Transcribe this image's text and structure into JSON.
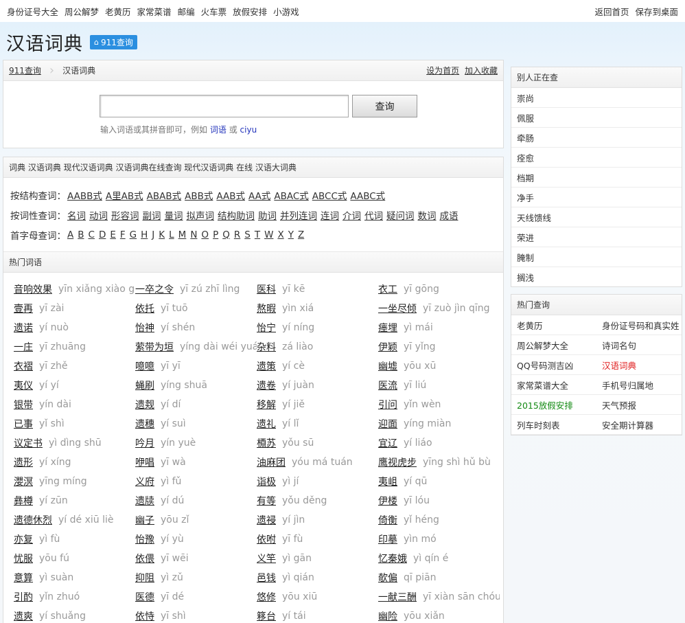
{
  "topbar": {
    "left_links": [
      "身份证号大全",
      "周公解梦",
      "老黄历",
      "家常菜谱",
      "邮编",
      "火车票",
      "放假安排",
      "小游戏"
    ],
    "right_links": [
      "返回首页",
      "保存到桌面"
    ]
  },
  "brand": {
    "title": "汉语词典",
    "badge": "911查询"
  },
  "search_panel": {
    "crumb_home": "911查询",
    "crumb_current": "汉语词典",
    "set_home": "设为首页",
    "add_fav": "加入收藏",
    "input_value": "",
    "button": "查询",
    "hint_prefix": "输入词语或其拼音即可，例如",
    "hint_ex1": "词语",
    "hint_or": "或",
    "hint_ex2": "ciyu"
  },
  "dict_panel": {
    "header": "词典 汉语词典 现代汉语词典 汉语词典在线查询 现代汉语词典 在线 汉语大词典",
    "structure_label": "按结构查词：",
    "structure_links": [
      "AABB式",
      "A里AB式",
      "ABAB式",
      "ABB式",
      "AAB式",
      "AA式",
      "ABAC式",
      "ABCC式",
      "AABC式"
    ],
    "pos_label": "按词性查词：",
    "pos_links": [
      "名词",
      "动词",
      "形容词",
      "副词",
      "量词",
      "拟声词",
      "结构助词",
      "助词",
      "并列连词",
      "连词",
      "介词",
      "代词",
      "疑问词",
      "数词",
      "成语"
    ],
    "initial_label": "首字母查词：",
    "letters": [
      "A",
      "B",
      "C",
      "D",
      "E",
      "F",
      "G",
      "H",
      "J",
      "K",
      "L",
      "M",
      "N",
      "O",
      "P",
      "Q",
      "R",
      "S",
      "T",
      "W",
      "X",
      "Y",
      "Z"
    ],
    "hot_header": "热门词语",
    "words": [
      {
        "w": "音响效果",
        "p": "yīn xiǎng xiào guǒ"
      },
      {
        "w": "一卒之令",
        "p": "yī zú zhī lìng"
      },
      {
        "w": "医科",
        "p": "yī kē"
      },
      {
        "w": "衣工",
        "p": "yī gōng"
      },
      {
        "w": "壹再",
        "p": "yī zài"
      },
      {
        "w": "依托",
        "p": "yī tuō"
      },
      {
        "w": "熬暇",
        "p": "yìn xiá"
      },
      {
        "w": "一坐尽倾",
        "p": "yī zuò jìn qīng"
      },
      {
        "w": "遗诺",
        "p": "yí nuò"
      },
      {
        "w": "怡神",
        "p": "yí shén"
      },
      {
        "w": "怡宁",
        "p": "yí níng"
      },
      {
        "w": "瘗埋",
        "p": "yì mái"
      },
      {
        "w": "一庄",
        "p": "yī zhuāng"
      },
      {
        "w": "萦带为垣",
        "p": "yíng dài wéi yuán"
      },
      {
        "w": "杂料",
        "p": "zá liào"
      },
      {
        "w": "伊颖",
        "p": "yī yǐng"
      },
      {
        "w": "衣褶",
        "p": "yī zhě"
      },
      {
        "w": "噫噫",
        "p": "yī yī"
      },
      {
        "w": "遗策",
        "p": "yí cè"
      },
      {
        "w": "幽墟",
        "p": "yōu xū"
      },
      {
        "w": "夷仪",
        "p": "yí yí"
      },
      {
        "w": "蝇刷",
        "p": "yíng shuā"
      },
      {
        "w": "遗卷",
        "p": "yí juàn"
      },
      {
        "w": "医流",
        "p": "yī liú"
      },
      {
        "w": "银带",
        "p": "yín dài"
      },
      {
        "w": "遗觌",
        "p": "yí dí"
      },
      {
        "w": "移解",
        "p": "yí jiě"
      },
      {
        "w": "引问",
        "p": "yǐn wèn"
      },
      {
        "w": "已事",
        "p": "yǐ shì"
      },
      {
        "w": "遗穗",
        "p": "yí suì"
      },
      {
        "w": "遗礼",
        "p": "yí lǐ"
      },
      {
        "w": "迎面",
        "p": "yíng miàn"
      },
      {
        "w": "议定书",
        "p": "yì dìng shū"
      },
      {
        "w": "吟月",
        "p": "yín yuè"
      },
      {
        "w": "槱苏",
        "p": "yǒu sū"
      },
      {
        "w": "宜辽",
        "p": "yí liáo"
      },
      {
        "w": "遗形",
        "p": "yí xíng"
      },
      {
        "w": "咿唱",
        "p": "yī wà"
      },
      {
        "w": "油麻团",
        "p": "yóu má tuán"
      },
      {
        "w": "鹰视虎步",
        "p": "yīng shì hǔ bù"
      },
      {
        "w": "瀴溟",
        "p": "yīng míng"
      },
      {
        "w": "义府",
        "p": "yì fǔ"
      },
      {
        "w": "诣极",
        "p": "yì jí"
      },
      {
        "w": "夷岨",
        "p": "yí qū"
      },
      {
        "w": "彝樽",
        "p": "yí zūn"
      },
      {
        "w": "遗牍",
        "p": "yí dú"
      },
      {
        "w": "有等",
        "p": "yǒu děng"
      },
      {
        "w": "伊楼",
        "p": "yī lóu"
      },
      {
        "w": "遗德休烈",
        "p": "yí dé xiū liè"
      },
      {
        "w": "幽子",
        "p": "yōu zǐ"
      },
      {
        "w": "遗祲",
        "p": "yí jìn"
      },
      {
        "w": "倚衡",
        "p": "yǐ héng"
      },
      {
        "w": "亦复",
        "p": "yì fù"
      },
      {
        "w": "怡豫",
        "p": "yí yù"
      },
      {
        "w": "依咐",
        "p": "yī fù"
      },
      {
        "w": "印摹",
        "p": "yìn mó"
      },
      {
        "w": "忧服",
        "p": "yōu fú"
      },
      {
        "w": "依偎",
        "p": "yī wēi"
      },
      {
        "w": "义竿",
        "p": "yì gān"
      },
      {
        "w": "忆秦娥",
        "p": "yì qín é"
      },
      {
        "w": "意算",
        "p": "yì suàn"
      },
      {
        "w": "抑阻",
        "p": "yì zǔ"
      },
      {
        "w": "邑钱",
        "p": "yì qián"
      },
      {
        "w": "欹偏",
        "p": "qī piān"
      },
      {
        "w": "引酌",
        "p": "yǐn zhuó"
      },
      {
        "w": "医德",
        "p": "yī dé"
      },
      {
        "w": "悠修",
        "p": "yōu xiū"
      },
      {
        "w": "一献三酬",
        "p": "yī xiàn sān chóu"
      },
      {
        "w": "遗爽",
        "p": "yí shuǎng"
      },
      {
        "w": "依恃",
        "p": "yī shì"
      },
      {
        "w": "簃台",
        "p": "yí tái"
      },
      {
        "w": "幽险",
        "p": "yōu xiǎn"
      }
    ]
  },
  "others_panel": {
    "header": "别人正在查",
    "items": [
      "崇尚",
      "佩服",
      "牵肠",
      "痊愈",
      "档期",
      "净手",
      "天线馈线",
      "荣进",
      "腌制",
      "搁浅"
    ]
  },
  "hot_panel": {
    "header": "热门查询",
    "items": [
      {
        "label": "老黄历",
        "tone": "normal"
      },
      {
        "label": "身份证号码和真实姓",
        "tone": "normal"
      },
      {
        "label": "周公解梦大全",
        "tone": "normal"
      },
      {
        "label": "诗词名句",
        "tone": "normal"
      },
      {
        "label": "QQ号码测吉凶",
        "tone": "normal"
      },
      {
        "label": "汉语词典",
        "tone": "red"
      },
      {
        "label": "家常菜谱大全",
        "tone": "normal"
      },
      {
        "label": "手机号归属地",
        "tone": "normal"
      },
      {
        "label": "2015放假安排",
        "tone": "green"
      },
      {
        "label": "天气预报",
        "tone": "normal"
      },
      {
        "label": "列车时刻表",
        "tone": "normal"
      },
      {
        "label": "安全期计算器",
        "tone": "normal"
      }
    ]
  }
}
